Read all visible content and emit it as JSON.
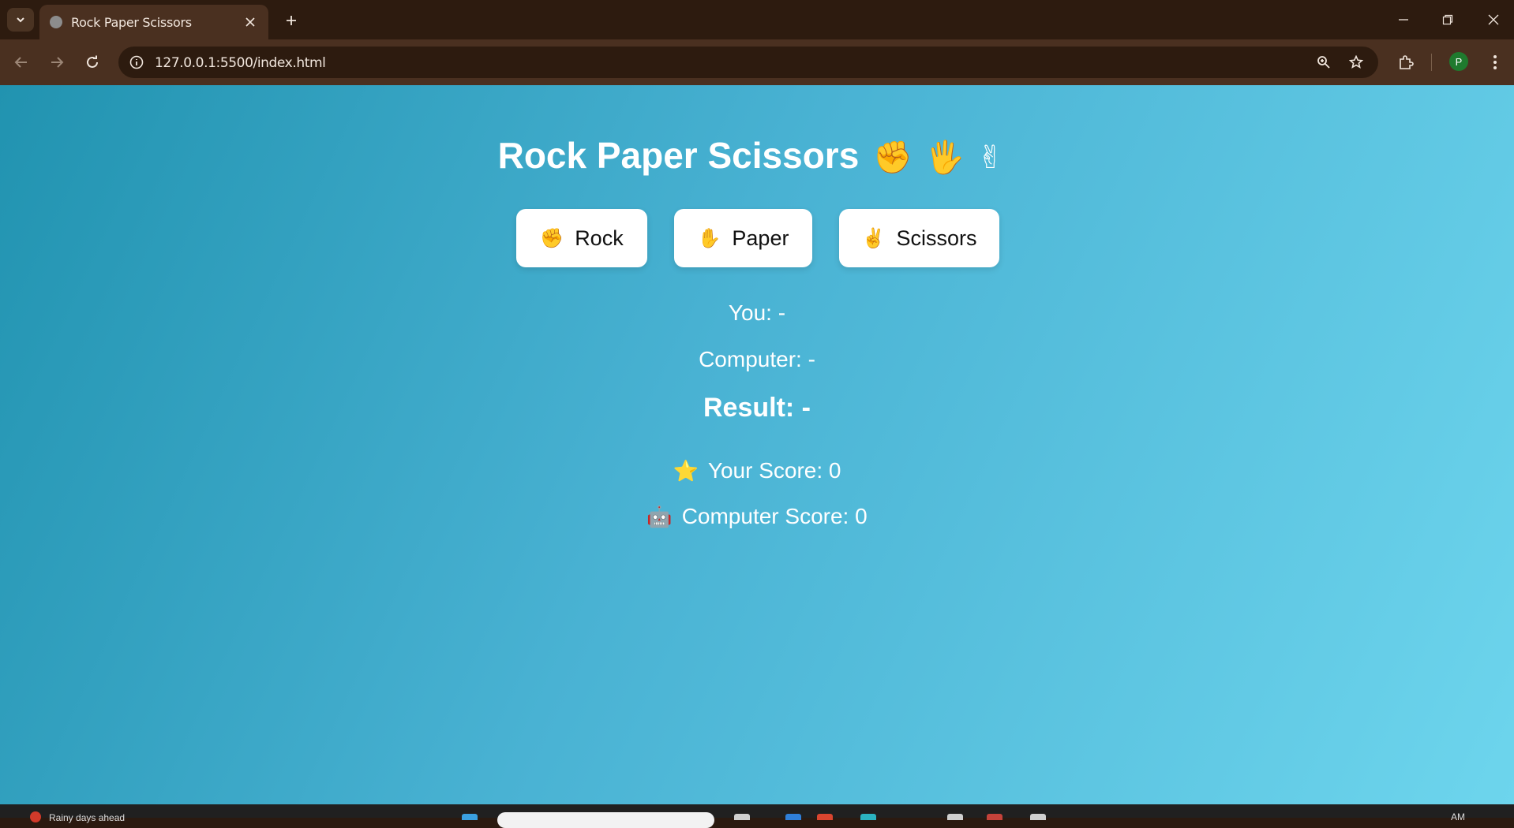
{
  "browser": {
    "tab_title": "Rock Paper Scissors",
    "url": "127.0.0.1:5500/index.html",
    "profile_initial": "P"
  },
  "game": {
    "title": "Rock Paper Scissors",
    "title_emojis": "✊🖐✌",
    "buttons": [
      {
        "icon": "✊",
        "label": "Rock"
      },
      {
        "icon": "✋",
        "label": "Paper"
      },
      {
        "icon": "✌",
        "label": "Scissors"
      }
    ],
    "you_choice": "You: -",
    "computer_choice": "Computer: -",
    "result": "Result: -",
    "your_score": {
      "icon": "⭐",
      "label": "Your Score: 0"
    },
    "computer_score": {
      "icon": "🤖",
      "label": "Computer Score: 0"
    }
  },
  "taskbar": {
    "weather": "Rainy days ahead",
    "clock": "AM"
  },
  "colors": {
    "gradient_start": "#2193b0",
    "gradient_end": "#6dd5ed",
    "chrome_dark": "#2d1b0f",
    "chrome_toolbar": "#4a3020"
  },
  "icons": [
    "tab-search-icon",
    "globe-icon",
    "close-icon",
    "plus-icon",
    "minimize-icon",
    "restore-icon",
    "back-arrow-icon",
    "forward-arrow-icon",
    "reload-icon",
    "site-info-icon",
    "zoom-icon",
    "star-icon",
    "extensions-icon",
    "menu-dots-icon"
  ]
}
